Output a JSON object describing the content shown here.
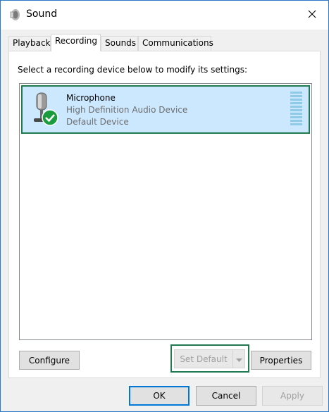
{
  "window": {
    "title": "Sound",
    "close_icon": "close-icon",
    "title_icon": "speaker-icon"
  },
  "tabs": [
    {
      "label": "Playback",
      "active": false
    },
    {
      "label": "Recording",
      "active": true
    },
    {
      "label": "Sounds",
      "active": false
    },
    {
      "label": "Communications",
      "active": false
    }
  ],
  "panel": {
    "instruction": "Select a recording device below to modify its settings:",
    "devices": [
      {
        "name": "Microphone",
        "description": "High Definition Audio Device",
        "status": "Default Device",
        "icon": "microphone-icon",
        "badge": "default-check-icon",
        "selected": true,
        "level": 0
      }
    ],
    "buttons": {
      "configure": {
        "label": "Configure",
        "enabled": true
      },
      "set_default": {
        "label": "Set Default",
        "enabled": false
      },
      "properties": {
        "label": "Properties",
        "enabled": true
      }
    }
  },
  "footer": {
    "ok": {
      "label": "OK",
      "enabled": true
    },
    "cancel": {
      "label": "Cancel",
      "enabled": true
    },
    "apply": {
      "label": "Apply",
      "enabled": false
    }
  },
  "colors": {
    "selection": "#cce8ff",
    "highlight_border": "#1f7a50",
    "accent": "#0078d7",
    "check_badge": "#1a9c3e"
  }
}
